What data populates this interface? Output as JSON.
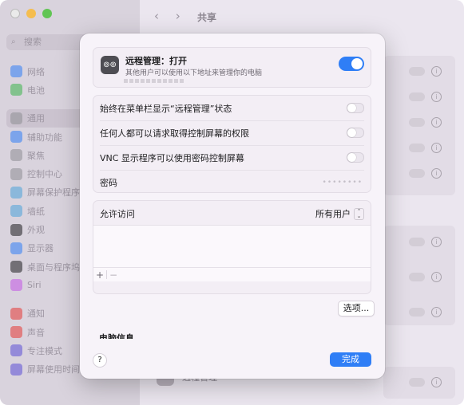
{
  "window": {
    "title": "共享"
  },
  "sidebar": {
    "search_placeholder": "搜索",
    "items": [
      {
        "label": "网络",
        "color": "#2f7ef6"
      },
      {
        "label": "电池",
        "color": "#3ab54a"
      },
      {
        "label": "通用",
        "color": "#8e8e93"
      },
      {
        "label": "辅助功能",
        "color": "#2f7ef6"
      },
      {
        "label": "聚焦",
        "color": "#8e8e93"
      },
      {
        "label": "控制中心",
        "color": "#8e8e93"
      },
      {
        "label": "屏幕保护程序",
        "color": "#4aa3d9"
      },
      {
        "label": "墙纸",
        "color": "#4aa3d9"
      },
      {
        "label": "外观",
        "color": "#1d1d1f"
      },
      {
        "label": "显示器",
        "color": "#2f7ef6"
      },
      {
        "label": "桌面与程序坞",
        "color": "#1d1d1f"
      },
      {
        "label": "Siri",
        "color": "#c355e6"
      },
      {
        "label": "通知",
        "color": "#e53935"
      },
      {
        "label": "声音",
        "color": "#e53935"
      },
      {
        "label": "专注模式",
        "color": "#5b4fd6"
      },
      {
        "label": "屏幕使用时间",
        "color": "#5b4fd6"
      }
    ]
  },
  "background_bottom": {
    "label": "远程管理"
  },
  "dialog": {
    "header": {
      "title": "远程管理：打开",
      "subtitle": "其他用户可以使用以下地址来管理你的电脑",
      "enabled": true
    },
    "settings": [
      {
        "label": "始终在菜单栏显示“远程管理”状态",
        "enabled": false
      },
      {
        "label": "任何人都可以请求取得控制屏幕的权限",
        "enabled": false
      },
      {
        "label": "VNC 显示程序可以使用密码控制屏幕",
        "enabled": false
      }
    ],
    "password": {
      "label": "密码",
      "value": "••••••••"
    },
    "access": {
      "label": "允许访问",
      "selected": "所有用户",
      "add": "+",
      "remove": "−"
    },
    "options_button": "选项...",
    "computer_info_label": "电脑信息",
    "help_button": "?",
    "done_button": "完成"
  }
}
